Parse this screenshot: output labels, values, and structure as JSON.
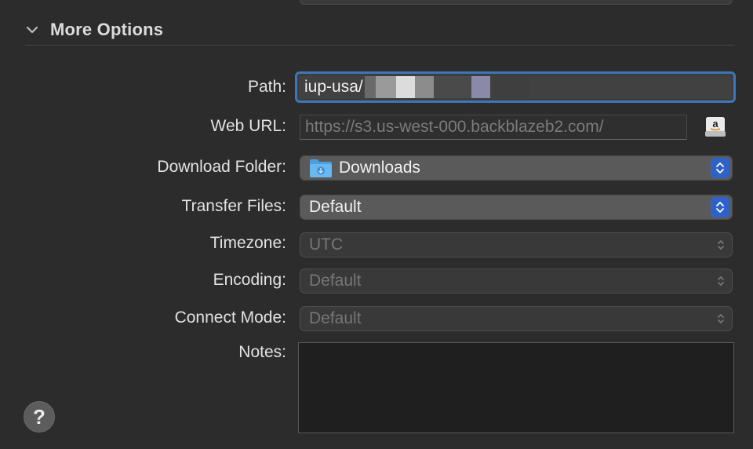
{
  "section": {
    "title": "More Options"
  },
  "fields": {
    "path": {
      "label": "Path:",
      "value": "iup-usa/"
    },
    "web_url": {
      "label": "Web URL:",
      "placeholder": "https://s3.us-west-000.backblazeb2.com/"
    },
    "download_folder": {
      "label": "Download Folder:",
      "value": "Downloads"
    },
    "transfer_files": {
      "label": "Transfer Files:",
      "value": "Default"
    },
    "timezone": {
      "label": "Timezone:",
      "value": "UTC"
    },
    "encoding": {
      "label": "Encoding:",
      "value": "Default"
    },
    "connect_mode": {
      "label": "Connect Mode:",
      "value": "Default"
    },
    "notes": {
      "label": "Notes:",
      "value": ""
    }
  },
  "help": {
    "label": "?"
  },
  "colors": {
    "accent": "#3d77b9",
    "popup_button": "#2e62c9"
  },
  "icons": {
    "section_toggle": "chevron-down-icon",
    "web_url_action": "amazon-drive-icon",
    "download_folder": "downloads-folder-icon",
    "popup_indicator": "up-down-arrows-icon"
  }
}
